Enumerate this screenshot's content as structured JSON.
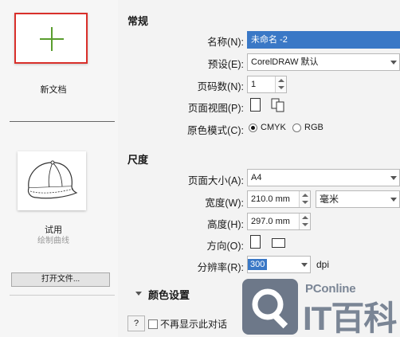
{
  "left_panel": {
    "new_doc_label": "新文档",
    "template_label": "试用",
    "template_sublabel": "绘制曲线",
    "open_file_button": "打开文件..."
  },
  "general": {
    "title": "常规",
    "name_label": "名称(N):",
    "name_value": "未命名 -2",
    "preset_label": "预设(E):",
    "preset_value": "CorelDRAW 默认",
    "pages_label": "页码数(N):",
    "pages_value": "1",
    "page_view_label": "页面视图(P):",
    "color_mode_label": "原色模式(C):",
    "color_mode_options": [
      "CMYK",
      "RGB"
    ],
    "color_mode_selected": "CMYK"
  },
  "size": {
    "title": "尺度",
    "page_size_label": "页面大小(A):",
    "page_size_value": "A4",
    "width_label": "宽度(W):",
    "width_value": "210.0 mm",
    "unit_value": "毫米",
    "height_label": "高度(H):",
    "height_value": "297.0 mm",
    "orientation_label": "方向(O):",
    "resolution_label": "分辨率(R):",
    "resolution_value": "300",
    "resolution_unit": "dpi"
  },
  "color_settings": {
    "title": "颜色设置"
  },
  "footer": {
    "help_button": "?",
    "dont_show_label": "不再显示此对话"
  },
  "watermark": {
    "brand_small": "PConline",
    "brand_large": "IT百科"
  },
  "colors": {
    "highlight": "#d9302b",
    "plus": "#5a9d2e",
    "selection": "#3a78c6",
    "watermark": "#6d7889"
  }
}
